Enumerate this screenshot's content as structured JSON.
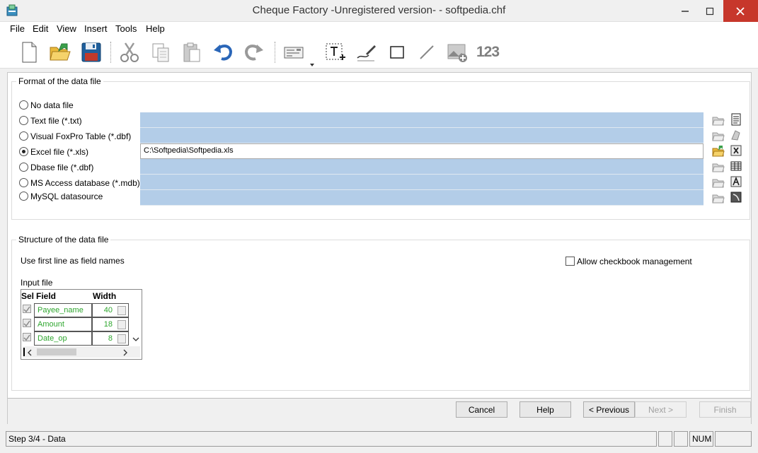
{
  "window": {
    "title": "Cheque Factory -Unregistered version- - softpedia.chf"
  },
  "menu": [
    "File",
    "Edit",
    "View",
    "Insert",
    "Tools",
    "Help"
  ],
  "toolbar": {
    "numbers_label": "123"
  },
  "format_group": {
    "label": "Format of the data file",
    "options": [
      {
        "label": "No data file",
        "checked": false
      },
      {
        "label": "Text file (*.txt)",
        "checked": false
      },
      {
        "label": "Visual FoxPro Table (*.dbf)",
        "checked": false
      },
      {
        "label": "Excel file (*.xls)",
        "checked": true
      },
      {
        "label": "Dbase file (*.dbf)",
        "checked": false
      },
      {
        "label": "MS Access database (*.mdb)",
        "checked": false
      },
      {
        "label": "MySQL datasource",
        "checked": false
      }
    ],
    "excel_path": "C:\\Softpedia\\Softpedia.xls"
  },
  "structure_group": {
    "label": "Structure of the data file",
    "first_line_label": "Use first line as field names",
    "allow_checkbook_label": "Allow checkbook management",
    "input_file_label": "Input file",
    "grid": {
      "col_sel": "Sel",
      "col_field": "Field",
      "col_width": "Width",
      "rows": [
        {
          "field": "Payee_name",
          "width": "40"
        },
        {
          "field": "Amount",
          "width": "18"
        },
        {
          "field": "Date_op",
          "width": "8"
        }
      ]
    }
  },
  "buttons": {
    "cancel": "Cancel",
    "help": "Help",
    "previous": "< Previous",
    "next": "Next >",
    "finish": "Finish"
  },
  "status": {
    "step": "Step 3/4 - Data",
    "num": "NUM"
  }
}
